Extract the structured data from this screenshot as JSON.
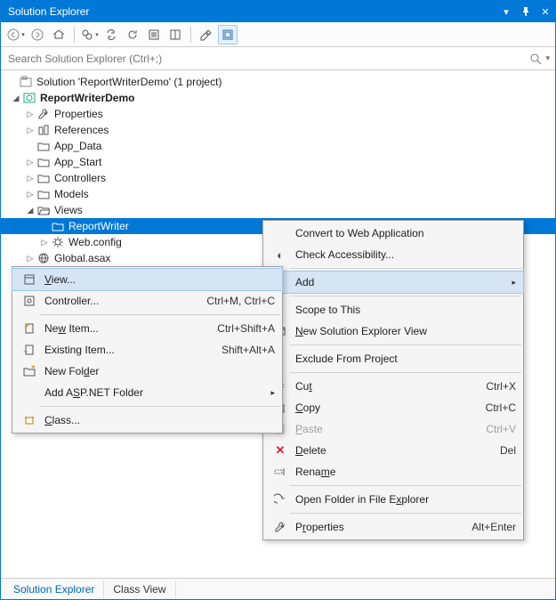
{
  "title": "Solution Explorer",
  "search_placeholder": "Search Solution Explorer (Ctrl+;)",
  "tree": {
    "solution": "Solution 'ReportWriterDemo' (1 project)",
    "project": "ReportWriterDemo",
    "properties": "Properties",
    "references": "References",
    "app_data": "App_Data",
    "app_start": "App_Start",
    "controllers": "Controllers",
    "models": "Models",
    "views": "Views",
    "reportwriter": "ReportWriter",
    "webconfig": "Web.config",
    "globalasax": "Global.asax"
  },
  "context": {
    "convert": "Convert to Web Application",
    "check": "Check Accessibility...",
    "add": "Add",
    "scope": "Scope to This",
    "newview": "New Solution Explorer View",
    "exclude": "Exclude From Project",
    "cut": {
      "label": "Cut",
      "shortcut": "Ctrl+X",
      "acc": "t"
    },
    "copy": {
      "label": "Copy",
      "shortcut": "Ctrl+C",
      "acc": "C"
    },
    "paste": {
      "label": "Paste",
      "shortcut": "Ctrl+V",
      "acc": "P"
    },
    "delete": {
      "label": "Delete",
      "shortcut": "Del",
      "acc": "D"
    },
    "rename": {
      "label": "Rename",
      "acc": "m"
    },
    "openfolder": {
      "label": "Open Folder in File Explorer",
      "acc": "x"
    },
    "props": {
      "label": "Properties",
      "shortcut": "Alt+Enter",
      "acc": "R"
    }
  },
  "submenu": {
    "view": {
      "label": "View...",
      "acc": "V"
    },
    "controller": {
      "label": "Controller...",
      "shortcut": "Ctrl+M, Ctrl+C"
    },
    "newitem": {
      "label": "New Item...",
      "shortcut": "Ctrl+Shift+A",
      "acc": "W"
    },
    "existing": {
      "label": "Existing Item...",
      "shortcut": "Shift+Alt+A",
      "acc": "g"
    },
    "newfolder": {
      "label": "New Folder",
      "acc": "d"
    },
    "aspnet": {
      "label": "Add ASP.NET Folder",
      "acc": "S"
    },
    "class": {
      "label": "Class...",
      "acc": "C"
    }
  },
  "tabs": {
    "slnexp": "Solution Explorer",
    "classview": "Class View"
  }
}
